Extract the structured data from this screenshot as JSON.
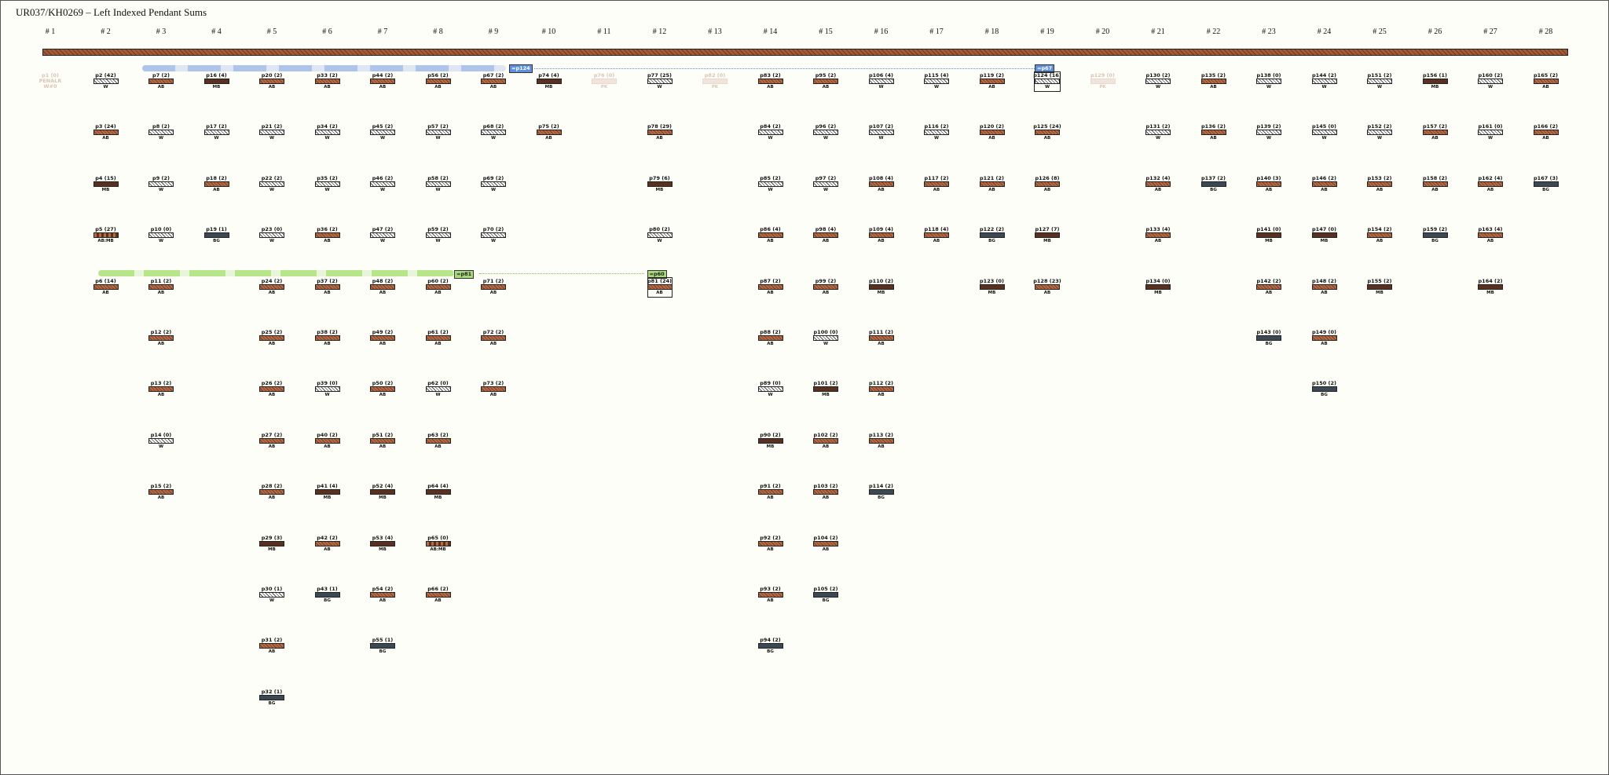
{
  "title": "UR037/KH0269 – Left Indexed Pendant Sums",
  "groups": [
    "# 1",
    "# 2",
    "# 3",
    "# 4",
    "# 5",
    "# 6",
    "# 7",
    "# 8",
    "# 9",
    "# 10",
    "# 11",
    "# 12",
    "# 13",
    "# 14",
    "# 15",
    "# 16",
    "# 17",
    "# 18",
    "# 19",
    "# 20",
    "# 21",
    "# 22",
    "# 23",
    "# 24",
    "# 25",
    "# 26",
    "# 27",
    "# 28"
  ],
  "colors": {
    "blue_band": "#aec4ea",
    "blue_tag": "#5f8fdf",
    "green_band": "#b6e58a",
    "green_tag": "#a8d97a",
    "AB": "#b86a45",
    "MB": "#5a3020",
    "BG": "#3d4855",
    "W": "#ffffff"
  },
  "sum_tags": {
    "blue_left": "=p124",
    "blue_right": "=p67",
    "green_left": "=p81",
    "green_right": "=p60"
  },
  "columns": [
    [
      {
        "l": "p1 (0)",
        "c": "PK",
        "t": "PK",
        "sub": "p1 (0)",
        "faded": true,
        "lines": [
          "p1 (0)",
          "PENALR",
          "W#0"
        ]
      }
    ],
    [
      {
        "l": "p2 (42)",
        "c": "W"
      },
      {
        "l": "p3 (24)",
        "c": "AB"
      },
      {
        "l": "p4 (15)",
        "c": "MB"
      },
      {
        "l": "p5 (27)",
        "c": "AB:MB"
      },
      {
        "l": "p6 (14)",
        "c": "AB"
      }
    ],
    [
      {
        "l": "p7 (2)",
        "c": "AB"
      },
      {
        "l": "p8 (2)",
        "c": "W"
      },
      {
        "l": "p9 (2)",
        "c": "W"
      },
      {
        "l": "p10 (0)",
        "c": "W"
      },
      {
        "l": "p11 (2)",
        "c": "AB"
      },
      {
        "l": "p12 (2)",
        "c": "AB"
      },
      {
        "l": "p13 (2)",
        "c": "AB"
      },
      {
        "l": "p14 (0)",
        "c": "W"
      },
      {
        "l": "p15 (2)",
        "c": "AB"
      }
    ],
    [
      {
        "l": "p16 (4)",
        "c": "MB"
      },
      {
        "l": "p17 (2)",
        "c": "W"
      },
      {
        "l": "p18 (2)",
        "c": "AB"
      },
      {
        "l": "p19 (1)",
        "c": "BG"
      }
    ],
    [
      {
        "l": "p20 (2)",
        "c": "AB"
      },
      {
        "l": "p21 (2)",
        "c": "W"
      },
      {
        "l": "p22 (2)",
        "c": "W"
      },
      {
        "l": "p23 (0)",
        "c": "W"
      },
      {
        "l": "p24 (2)",
        "c": "AB"
      },
      {
        "l": "p25 (2)",
        "c": "AB"
      },
      {
        "l": "p26 (2)",
        "c": "AB"
      },
      {
        "l": "p27 (2)",
        "c": "AB"
      },
      {
        "l": "p28 (2)",
        "c": "AB"
      },
      {
        "l": "p29 (3)",
        "c": "MB"
      },
      {
        "l": "p30 (1)",
        "c": "W"
      },
      {
        "l": "p31 (2)",
        "c": "AB"
      },
      {
        "l": "p32 (1)",
        "c": "BG"
      }
    ],
    [
      {
        "l": "p33 (2)",
        "c": "AB"
      },
      {
        "l": "p34 (2)",
        "c": "W"
      },
      {
        "l": "p35 (2)",
        "c": "W"
      },
      {
        "l": "p36 (2)",
        "c": "AB"
      },
      {
        "l": "p37 (2)",
        "c": "AB"
      },
      {
        "l": "p38 (2)",
        "c": "AB"
      },
      {
        "l": "p39 (0)",
        "c": "W"
      },
      {
        "l": "p40 (2)",
        "c": "AB"
      },
      {
        "l": "p41 (4)",
        "c": "MB"
      },
      {
        "l": "p42 (2)",
        "c": "AB"
      },
      {
        "l": "p43 (1)",
        "c": "BG"
      }
    ],
    [
      {
        "l": "p44 (2)",
        "c": "AB"
      },
      {
        "l": "p45 (2)",
        "c": "W"
      },
      {
        "l": "p46 (2)",
        "c": "W"
      },
      {
        "l": "p47 (2)",
        "c": "W"
      },
      {
        "l": "p48 (2)",
        "c": "AB"
      },
      {
        "l": "p49 (2)",
        "c": "AB"
      },
      {
        "l": "p50 (2)",
        "c": "AB"
      },
      {
        "l": "p51 (2)",
        "c": "AB"
      },
      {
        "l": "p52 (4)",
        "c": "MB"
      },
      {
        "l": "p53 (4)",
        "c": "MB"
      },
      {
        "l": "p54 (2)",
        "c": "AB"
      },
      {
        "l": "p55 (1)",
        "c": "BG"
      }
    ],
    [
      {
        "l": "p56 (2)",
        "c": "AB"
      },
      {
        "l": "p57 (2)",
        "c": "W"
      },
      {
        "l": "p58 (2)",
        "c": "W"
      },
      {
        "l": "p59 (2)",
        "c": "W"
      },
      {
        "l": "p60 (2)",
        "c": "AB"
      },
      {
        "l": "p61 (2)",
        "c": "AB"
      },
      {
        "l": "p62 (0)",
        "c": "W"
      },
      {
        "l": "p63 (2)",
        "c": "AB"
      },
      {
        "l": "p64 (4)",
        "c": "MB"
      },
      {
        "l": "p65 (0)",
        "c": "AB:MB"
      },
      {
        "l": "p66 (2)",
        "c": "AB"
      }
    ],
    [
      {
        "l": "p67 (2)",
        "c": "AB"
      },
      {
        "l": "p68 (2)",
        "c": "W"
      },
      {
        "l": "p69 (2)",
        "c": "W"
      },
      {
        "l": "p70 (2)",
        "c": "W"
      },
      {
        "l": "p71 (2)",
        "c": "AB"
      },
      {
        "l": "p72 (2)",
        "c": "AB"
      },
      {
        "l": "p73 (2)",
        "c": "AB"
      }
    ],
    [
      {
        "l": "p74 (4)",
        "c": "MB"
      },
      {
        "l": "p75 (2)",
        "c": "AB"
      }
    ],
    [
      {
        "l": "p76 (0)",
        "c": "PK",
        "faded": true
      }
    ],
    [
      {
        "l": "p77 (25)",
        "c": "W"
      },
      {
        "l": "p78 (29)",
        "c": "AB"
      },
      {
        "l": "p79 (6)",
        "c": "MB"
      },
      {
        "l": "p80 (2)",
        "c": "W"
      },
      {
        "l": "p81 (24)",
        "c": "AB"
      }
    ],
    [
      {
        "l": "p82 (0)",
        "c": "PK",
        "faded": true
      }
    ],
    [
      {
        "l": "p83 (2)",
        "c": "AB"
      },
      {
        "l": "p84 (2)",
        "c": "W"
      },
      {
        "l": "p85 (2)",
        "c": "W"
      },
      {
        "l": "p86 (4)",
        "c": "AB"
      },
      {
        "l": "p87 (2)",
        "c": "AB"
      },
      {
        "l": "p88 (2)",
        "c": "AB"
      },
      {
        "l": "p89 (0)",
        "c": "W"
      },
      {
        "l": "p90 (2)",
        "c": "MB"
      },
      {
        "l": "p91 (2)",
        "c": "AB"
      },
      {
        "l": "p92 (2)",
        "c": "AB"
      },
      {
        "l": "p93 (2)",
        "c": "AB"
      },
      {
        "l": "p94 (2)",
        "c": "BG"
      }
    ],
    [
      {
        "l": "p95 (2)",
        "c": "AB"
      },
      {
        "l": "p96 (2)",
        "c": "W"
      },
      {
        "l": "p97 (2)",
        "c": "W"
      },
      {
        "l": "p98 (4)",
        "c": "AB"
      },
      {
        "l": "p99 (2)",
        "c": "AB"
      },
      {
        "l": "p100 (0)",
        "c": "W"
      },
      {
        "l": "p101 (2)",
        "c": "MB"
      },
      {
        "l": "p102 (2)",
        "c": "AB"
      },
      {
        "l": "p103 (2)",
        "c": "AB"
      },
      {
        "l": "p104 (2)",
        "c": "AB"
      },
      {
        "l": "p105 (2)",
        "c": "BG"
      }
    ],
    [
      {
        "l": "p106 (4)",
        "c": "W"
      },
      {
        "l": "p107 (2)",
        "c": "W"
      },
      {
        "l": "p108 (4)",
        "c": "AB"
      },
      {
        "l": "p109 (4)",
        "c": "AB"
      },
      {
        "l": "p110 (2)",
        "c": "MB"
      },
      {
        "l": "p111 (2)",
        "c": "AB"
      },
      {
        "l": "p112 (2)",
        "c": "AB"
      },
      {
        "l": "p113 (2)",
        "c": "AB"
      },
      {
        "l": "p114 (2)",
        "c": "BG"
      }
    ],
    [
      {
        "l": "p115 (4)",
        "c": "W"
      },
      {
        "l": "p116 (2)",
        "c": "W"
      },
      {
        "l": "p117 (2)",
        "c": "AB"
      },
      {
        "l": "p118 (4)",
        "c": "AB"
      }
    ],
    [
      {
        "l": "p119 (2)",
        "c": "AB"
      },
      {
        "l": "p120 (2)",
        "c": "AB"
      },
      {
        "l": "p121 (2)",
        "c": "AB"
      },
      {
        "l": "p122 (2)",
        "c": "BG"
      },
      {
        "l": "p123 (0)",
        "c": "MB"
      }
    ],
    [
      {
        "l": "p124 (16)",
        "c": "W"
      },
      {
        "l": "p125 (24)",
        "c": "AB"
      },
      {
        "l": "p126 (8)",
        "c": "AB"
      },
      {
        "l": "p127 (7)",
        "c": "MB"
      },
      {
        "l": "p128 (23)",
        "c": "AB"
      }
    ],
    [
      {
        "l": "p129 (0)",
        "c": "PK",
        "faded": true
      }
    ],
    [
      {
        "l": "p130 (2)",
        "c": "W"
      },
      {
        "l": "p131 (2)",
        "c": "W"
      },
      {
        "l": "p132 (4)",
        "c": "AB"
      },
      {
        "l": "p133 (4)",
        "c": "AB"
      },
      {
        "l": "p134 (0)",
        "c": "MB"
      }
    ],
    [
      {
        "l": "p135 (2)",
        "c": "AB"
      },
      {
        "l": "p136 (2)",
        "c": "AB"
      },
      {
        "l": "p137 (2)",
        "c": "BG"
      }
    ],
    [
      {
        "l": "p138 (0)",
        "c": "W"
      },
      {
        "l": "p139 (2)",
        "c": "W"
      },
      {
        "l": "p140 (3)",
        "c": "AB"
      },
      {
        "l": "p141 (0)",
        "c": "MB"
      },
      {
        "l": "p142 (2)",
        "c": "AB"
      },
      {
        "l": "p143 (0)",
        "c": "BG"
      }
    ],
    [
      {
        "l": "p144 (2)",
        "c": "W"
      },
      {
        "l": "p145 (0)",
        "c": "W"
      },
      {
        "l": "p146 (2)",
        "c": "AB"
      },
      {
        "l": "p147 (0)",
        "c": "MB"
      },
      {
        "l": "p148 (2)",
        "c": "AB"
      },
      {
        "l": "p149 (0)",
        "c": "AB"
      },
      {
        "l": "p150 (2)",
        "c": "BG"
      }
    ],
    [
      {
        "l": "p151 (2)",
        "c": "W"
      },
      {
        "l": "p152 (2)",
        "c": "W"
      },
      {
        "l": "p153 (2)",
        "c": "AB"
      },
      {
        "l": "p154 (2)",
        "c": "AB"
      },
      {
        "l": "p155 (2)",
        "c": "MB"
      }
    ],
    [
      {
        "l": "p156 (1)",
        "c": "MB"
      },
      {
        "l": "p157 (2)",
        "c": "AB"
      },
      {
        "l": "p158 (2)",
        "c": "AB"
      },
      {
        "l": "p159 (2)",
        "c": "BG"
      }
    ],
    [
      {
        "l": "p160 (2)",
        "c": "W"
      },
      {
        "l": "p161 (0)",
        "c": "W"
      },
      {
        "l": "p162 (4)",
        "c": "AB"
      },
      {
        "l": "p163 (4)",
        "c": "AB"
      },
      {
        "l": "p164 (2)",
        "c": "MB"
      }
    ],
    [
      {
        "l": "p165 (2)",
        "c": "AB"
      },
      {
        "l": "p166 (2)",
        "c": "AB"
      },
      {
        "l": "p167 (3)",
        "c": "BG"
      }
    ]
  ]
}
